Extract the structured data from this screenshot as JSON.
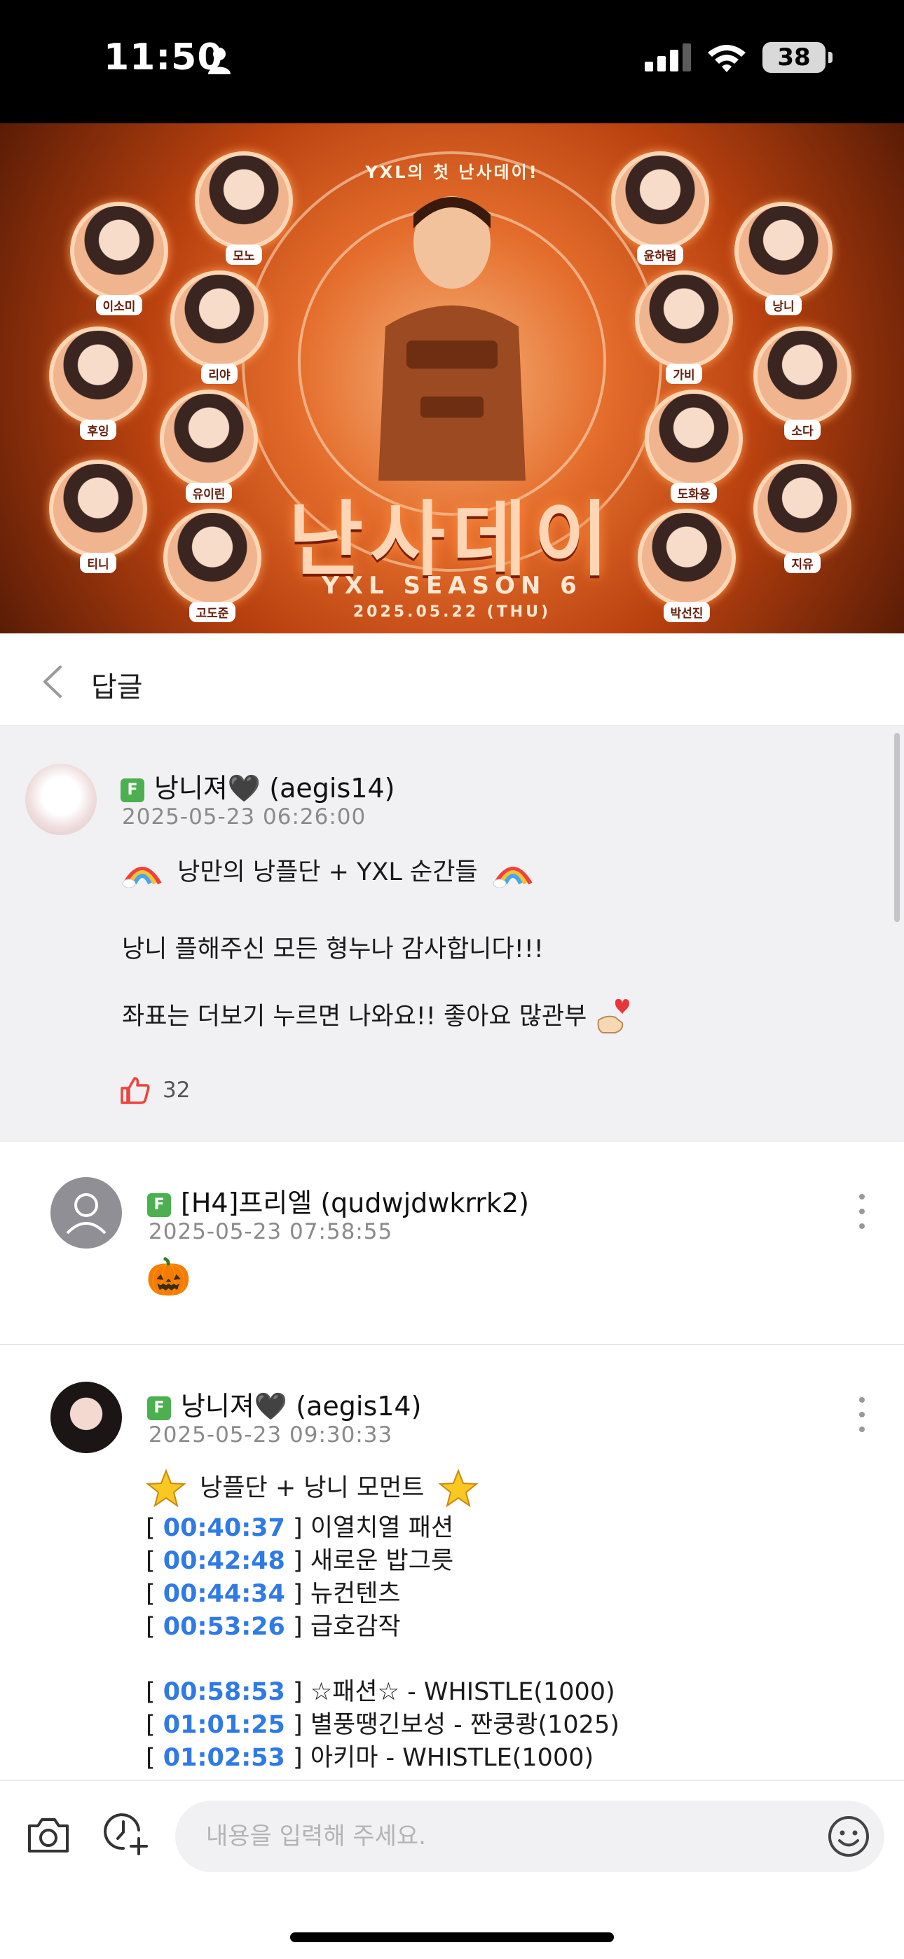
{
  "status_bar": {
    "time": "11:50",
    "battery": "38"
  },
  "banner": {
    "top_text": "YXL의 첫 난사데이!",
    "title": "난사데이",
    "season": "YXL SEASON 6",
    "date": "2025.05.22 (THU)",
    "members_left": [
      "이소미",
      "후잉",
      "티니",
      "고도준"
    ],
    "members_inner_left": [
      "모노",
      "리야",
      "유이린"
    ],
    "members_inner_right": [
      "윤하렴",
      "가비",
      "도화용"
    ],
    "members_right": [
      "낭니",
      "소다",
      "지유",
      "박선진"
    ]
  },
  "header": {
    "title": "답글"
  },
  "main_comment": {
    "grade": "F",
    "author": "낭니져🖤 (aegis14)",
    "time": "2025-05-23 06:26:00",
    "line1": "낭만의 낭플단 + YXL 순간들",
    "line2": "낭니 플해주신 모든 형누나 감사합니다!!!",
    "line3": "좌표는 더보기 누르면 나와요!! 좋아요 많관부",
    "likes": "32"
  },
  "reply1": {
    "grade": "F",
    "author": "[H4]프리엘 (qudwjdwkrrk2)",
    "time": "2025-05-23 07:58:55",
    "emoji": "🎃"
  },
  "reply2": {
    "grade": "F",
    "author": "낭니져🖤 (aegis14)",
    "time": "2025-05-23 09:30:33",
    "heading": "낭플단 + 낭니 모먼트",
    "group1": [
      {
        "ts": "00:40:37",
        "text": "이열치열 패션"
      },
      {
        "ts": "00:42:48",
        "text": "새로운 밥그릇"
      },
      {
        "ts": "00:44:34",
        "text": "뉴컨텐츠"
      },
      {
        "ts": "00:53:26",
        "text": "급호감작"
      }
    ],
    "group2": [
      {
        "ts": "00:58:53",
        "text": "☆패션☆ - WHISTLE(1000)"
      },
      {
        "ts": "01:01:25",
        "text": "별풍땡긴보성 - 짠쿵쾅(1025)"
      },
      {
        "ts": "01:02:53",
        "text": "아키마 - WHISTLE(1000)"
      }
    ]
  },
  "input": {
    "placeholder": "내용을 입력해 주세요."
  },
  "colors": {
    "accent_blue": "#2f7ae5",
    "grade_green": "#4caf50",
    "like_red": "#f0413a"
  }
}
